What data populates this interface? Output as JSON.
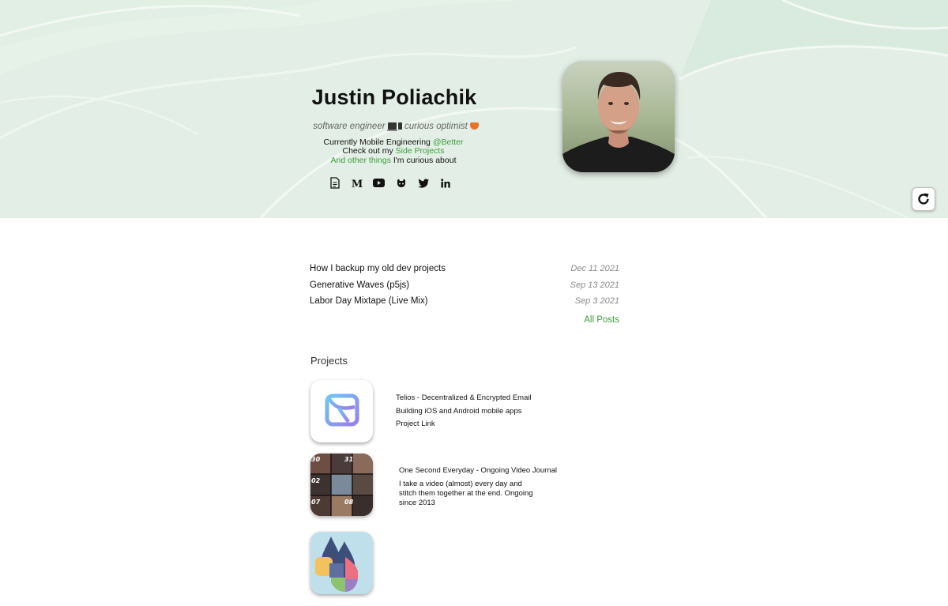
{
  "profile": {
    "name": "Justin Poliachik",
    "tagline_part1": "software engineer",
    "tagline_part2": "curious optimist",
    "bio_line1_prefix": "Currently Mobile Engineering ",
    "bio_line1_link": "@Better",
    "bio_line2_prefix": "Check out my ",
    "bio_line2_link": "Side Projects",
    "bio_line3_link": "And other things",
    "bio_line3_suffix": " I'm curious about"
  },
  "social_icons": [
    "resume-icon",
    "medium-icon",
    "youtube-icon",
    "github-icon",
    "twitter-icon",
    "linkedin-icon"
  ],
  "colors": {
    "hero_bg": "#e3efe6",
    "accent_green": "#3e9c3e",
    "date_gray": "#8a8a8a"
  },
  "posts": [
    {
      "title": "How I backup my old dev projects",
      "date": "Dec 11 2021"
    },
    {
      "title": "Generative Waves (p5js)",
      "date": "Sep 13 2021"
    },
    {
      "title": "Labor Day Mixtape (Live Mix)",
      "date": "Sep 3 2021"
    }
  ],
  "all_posts_label": "All Posts",
  "projects_heading": "Projects",
  "projects": [
    {
      "title": "Telios - Decentralized & Encrypted Email",
      "desc": "Building iOS and Android mobile apps",
      "link": "Project Link"
    },
    {
      "title": "One Second Everyday - Ongoing Video Journal",
      "desc_line1": "I take a video (almost) every day and",
      "desc_line2": "stitch them together at the end. Ongoing",
      "desc_line3": "since 2013"
    }
  ]
}
